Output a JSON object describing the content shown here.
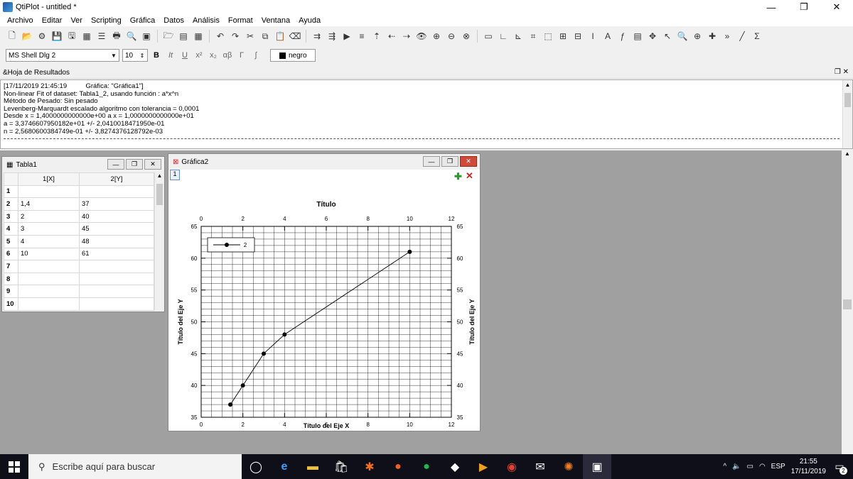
{
  "window": {
    "title": "QtiPlot - untitled *"
  },
  "menu": [
    "Archivo",
    "Editar",
    "Ver",
    "Scripting",
    "Gráfica",
    "Datos",
    "Análisis",
    "Format",
    "Ventana",
    "Ayuda"
  ],
  "format_bar": {
    "font": "MS Shell Dlg 2",
    "size": "10",
    "color_label": "negro"
  },
  "results_panel": {
    "title": "&Hoja de Resultados",
    "lines": [
      "[17/11/2019 21:45:19          Gráfica: \"Gráfica1\"]",
      "Non-linear Fit of dataset: Tabla1_2, usando función : a*x^n",
      "Método de Pesado: Sin pesado",
      "Levenberg-Marquardt escalado algoritmo con tolerancia = 0,0001",
      "Desde x = 1,4000000000000e+00 a x = 1,0000000000000e+01",
      "a = 3,3746607950182e+01 +/- 2,0410018471950e-01",
      "n = 2,5680600384749e-01 +/- 3,8274376128792e-03"
    ]
  },
  "table_window": {
    "title": "Tabla1",
    "columns": [
      "1[X]",
      "2[Y]"
    ],
    "rows": [
      {
        "n": "1",
        "x": "",
        "y": ""
      },
      {
        "n": "2",
        "x": "1,4",
        "y": "37"
      },
      {
        "n": "3",
        "x": "2",
        "y": "40"
      },
      {
        "n": "4",
        "x": "3",
        "y": "45"
      },
      {
        "n": "5",
        "x": "4",
        "y": "48"
      },
      {
        "n": "6",
        "x": "10",
        "y": "61"
      },
      {
        "n": "7",
        "x": "",
        "y": ""
      },
      {
        "n": "8",
        "x": "",
        "y": ""
      },
      {
        "n": "9",
        "x": "",
        "y": ""
      },
      {
        "n": "10",
        "x": "",
        "y": ""
      }
    ]
  },
  "graph_window": {
    "title": "Gráfica2",
    "layer_label": "1"
  },
  "chart_data": {
    "type": "scatter",
    "title": "Título",
    "xlabel": "Título del Eje X",
    "ylabel": "Título del Eje Y",
    "xlim": [
      0,
      12
    ],
    "ylim": [
      35,
      65
    ],
    "xticks": [
      0,
      2,
      4,
      6,
      8,
      10,
      12
    ],
    "yticks": [
      35,
      40,
      45,
      50,
      55,
      60,
      65
    ],
    "grid": true,
    "legend": "top-left",
    "series": [
      {
        "name": "2",
        "x": [
          1.4,
          2,
          3,
          4,
          10
        ],
        "y": [
          37,
          40,
          45,
          48,
          61
        ]
      }
    ],
    "fit_curve": {
      "a": 33.746607950182,
      "n": 0.25680600384749,
      "x_from": 1.4,
      "x_to": 10
    }
  },
  "taskbar": {
    "search_placeholder": "Escribe aquí para buscar",
    "lang": "ESP",
    "time": "21:55",
    "date": "17/11/2019",
    "notif_count": "2"
  }
}
